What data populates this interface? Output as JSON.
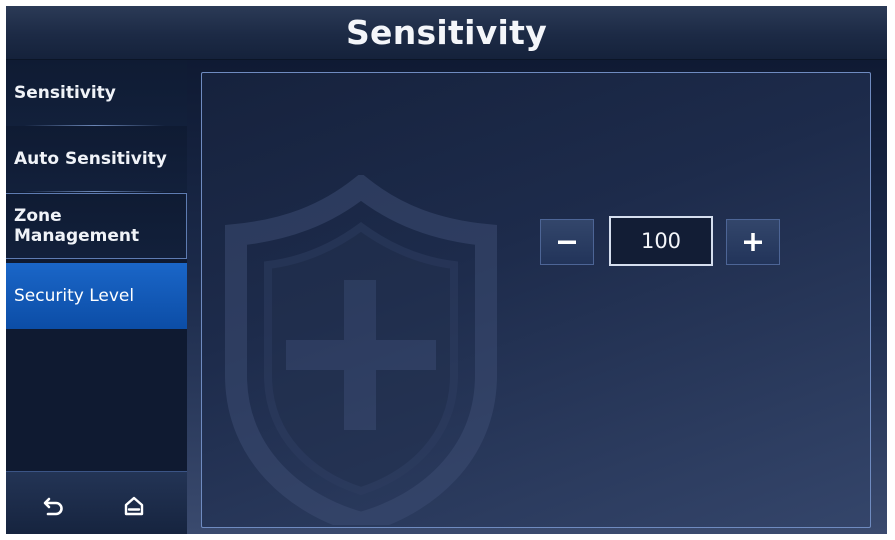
{
  "header": {
    "title": "Sensitivity"
  },
  "sidebar": {
    "items": [
      {
        "label": "Sensitivity",
        "active": false
      },
      {
        "label": "Auto Sensitivity",
        "active": false
      },
      {
        "label": "Zone Management",
        "active": false
      },
      {
        "label": "Security Level",
        "active": true
      }
    ]
  },
  "bottom_nav": {
    "back_icon": "back-arrow-icon",
    "home_icon": "home-icon"
  },
  "stepper": {
    "value": "100",
    "minus_icon": "minus-icon",
    "plus_icon": "plus-icon"
  },
  "watermark_icon": "shield-plus-icon",
  "colors": {
    "active_item": "#1a66c8",
    "background": "#15223b",
    "panel_border": "#6f8bc0"
  }
}
